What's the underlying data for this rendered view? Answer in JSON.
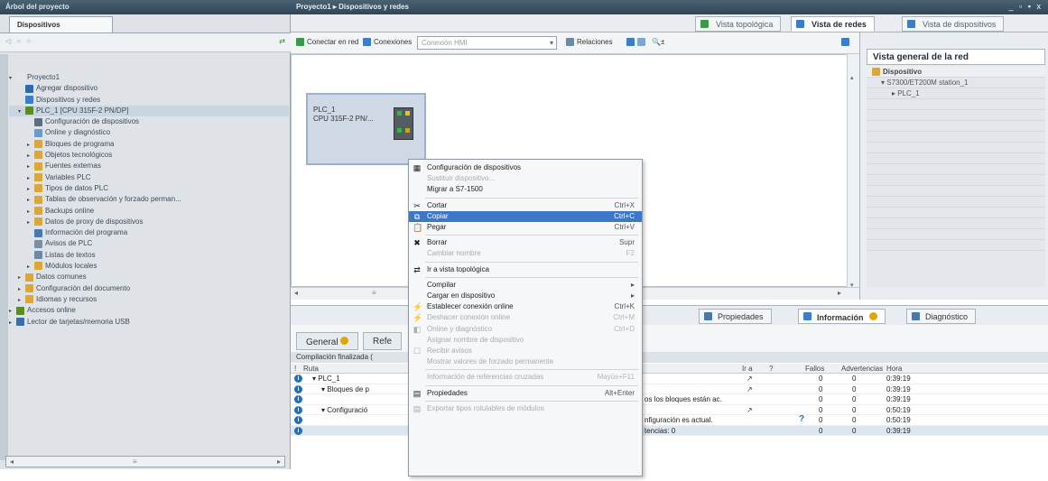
{
  "left_panel": {
    "title": "Árbol del proyecto",
    "tab": "Dispositivos",
    "tree": [
      {
        "label": "Proyecto1",
        "depth": 0,
        "arrow": "▾",
        "icon": "#e0e6ec"
      },
      {
        "label": "Agregar dispositivo",
        "depth": 1,
        "arrow": "",
        "icon": "#2b6cb0"
      },
      {
        "label": "Dispositivos y redes",
        "depth": 1,
        "arrow": "",
        "icon": "#3a7ec9"
      },
      {
        "label": "PLC_1 [CPU 315F-2 PN/DP]",
        "depth": 1,
        "arrow": "▾",
        "icon": "#5a8a2a",
        "selected": true
      },
      {
        "label": "Configuración de dispositivos",
        "depth": 2,
        "arrow": "",
        "icon": "#5e6e82"
      },
      {
        "label": "Online y diagnóstico",
        "depth": 2,
        "arrow": "",
        "icon": "#6a9ac9"
      },
      {
        "label": "Bloques de programa",
        "depth": 2,
        "arrow": "▸",
        "icon": "#d9a73a"
      },
      {
        "label": "Objetos tecnológicos",
        "depth": 2,
        "arrow": "▸",
        "icon": "#d9a73a"
      },
      {
        "label": "Fuentes externas",
        "depth": 2,
        "arrow": "▸",
        "icon": "#d9a73a"
      },
      {
        "label": "Variables PLC",
        "depth": 2,
        "arrow": "▸",
        "icon": "#d9a73a"
      },
      {
        "label": "Tipos de datos PLC",
        "depth": 2,
        "arrow": "▸",
        "icon": "#d9a73a"
      },
      {
        "label": "Tablas de observación y forzado perman...",
        "depth": 2,
        "arrow": "▸",
        "icon": "#d9a73a"
      },
      {
        "label": "Backups online",
        "depth": 2,
        "arrow": "▸",
        "icon": "#d9a73a"
      },
      {
        "label": "Datos de proxy de dispositivos",
        "depth": 2,
        "arrow": "▸",
        "icon": "#d9a73a"
      },
      {
        "label": "Información del programa",
        "depth": 2,
        "arrow": "",
        "icon": "#4a78a8"
      },
      {
        "label": "Avisos de PLC",
        "depth": 2,
        "arrow": "",
        "icon": "#7a8ea4"
      },
      {
        "label": "Listas de textos",
        "depth": 2,
        "arrow": "",
        "icon": "#6a8aa8"
      },
      {
        "label": "Módulos locales",
        "depth": 2,
        "arrow": "▸",
        "icon": "#d9a73a"
      },
      {
        "label": "Datos comunes",
        "depth": 1,
        "arrow": "▸",
        "icon": "#d9a73a"
      },
      {
        "label": "Configuración del documento",
        "depth": 1,
        "arrow": "▸",
        "icon": "#d9a73a"
      },
      {
        "label": "Idiomas y recursos",
        "depth": 1,
        "arrow": "▸",
        "icon": "#d9a73a"
      },
      {
        "label": "Accesos online",
        "depth": 0,
        "arrow": "▸",
        "icon": "#5a8a2a"
      },
      {
        "label": "Lector de tarjetas/memoria USB",
        "depth": 0,
        "arrow": "▸",
        "icon": "#3a6ea8"
      }
    ]
  },
  "header": {
    "breadcrumb": "Proyecto1 ▸ Dispositivos y redes",
    "window_controls": "_ ▫ ▪ x"
  },
  "view_tabs": [
    {
      "label": "Vista topológica",
      "active": false,
      "icon": "#3a9a4a"
    },
    {
      "label": "Vista de redes",
      "active": true,
      "icon": "#3a7ec9"
    },
    {
      "label": "Vista de dispositivos",
      "active": false,
      "icon": "#3a7ec9"
    }
  ],
  "net_toolbar": {
    "connect_label": "Conectar en red",
    "connections_label": "Conexiones",
    "connection_type": "Conexión HMI",
    "relations_label": "Relaciones",
    "zoom_label": "± "
  },
  "plc": {
    "name": "PLC_1",
    "cpu": "CPU 315F-2 PN/..."
  },
  "overview": {
    "title": "Vista general de la red",
    "header": "Dispositivo",
    "rows": [
      "S7300/ET200M station_1",
      "PLC_1"
    ]
  },
  "bottom_tabs": [
    {
      "label": "Propiedades",
      "active": false
    },
    {
      "label": "Información",
      "active": true
    },
    {
      "label": "Diagnóstico",
      "active": false
    }
  ],
  "sub_tabs": [
    "General",
    "Refe"
  ],
  "compile_status": "Compilación finalizada (",
  "table": {
    "headers": {
      "path": "Ruta",
      "ir": "Ir a",
      "q": "?",
      "errors": "Fallos",
      "warnings": "Advertencias",
      "time": "Hora"
    },
    "rows": [
      {
        "path": "▾ PLC_1",
        "desc": "",
        "arrow": "↗",
        "q": "",
        "errors": "0",
        "warnings": "0",
        "time": "0:39:19",
        "indent": 10,
        "selected": false
      },
      {
        "path": "▾ Bloques de p",
        "desc": "",
        "arrow": "↗",
        "q": "",
        "errors": "0",
        "warnings": "0",
        "time": "0:39:19",
        "indent": 20,
        "selected": false
      },
      {
        "path": "",
        "desc": "os los bloques están ac.",
        "arrow": "",
        "q": "",
        "errors": "0",
        "warnings": "0",
        "time": "0:39:19",
        "indent": 30,
        "selected": false
      },
      {
        "path": "▾ Configuració",
        "desc": "",
        "arrow": "↗",
        "q": "",
        "errors": "0",
        "warnings": "0",
        "time": "0:50:19",
        "indent": 20,
        "selected": false
      },
      {
        "path": "",
        "desc": "nfiguración es actual.",
        "arrow": "",
        "q": "?",
        "errors": "0",
        "warnings": "0",
        "time": "0:50:19",
        "indent": 30,
        "selected": false
      },
      {
        "path": "",
        "desc": "tencias: 0",
        "arrow": "",
        "q": "",
        "errors": "0",
        "warnings": "0",
        "time": "0:39:19",
        "indent": 30,
        "selected": true
      }
    ]
  },
  "context_menu": [
    {
      "label": "Configuración de dispositivos",
      "shortcut": "",
      "disabled": false,
      "icon": "▦"
    },
    {
      "label": "Sustituir dispositivo...",
      "shortcut": "",
      "disabled": true,
      "icon": ""
    },
    {
      "label": "Migrar a S7-1500",
      "shortcut": "",
      "disabled": false,
      "icon": ""
    },
    {
      "sep": true
    },
    {
      "label": "Cortar",
      "shortcut": "Ctrl+X",
      "disabled": false,
      "icon": "✂"
    },
    {
      "label": "Copiar",
      "shortcut": "Ctrl+C",
      "disabled": false,
      "icon": "⧉",
      "highlight": true
    },
    {
      "label": "Pegar",
      "shortcut": "Ctrl+V",
      "disabled": false,
      "icon": "📋"
    },
    {
      "sep": true
    },
    {
      "label": "Borrar",
      "shortcut": "Supr",
      "disabled": false,
      "icon": "✖"
    },
    {
      "label": "Cambiar nombre",
      "shortcut": "F2",
      "disabled": true,
      "icon": ""
    },
    {
      "sep": true
    },
    {
      "label": "Ir a vista topológica",
      "shortcut": "",
      "disabled": false,
      "icon": "⇄"
    },
    {
      "sep": true
    },
    {
      "label": "Compilar",
      "shortcut": "▸",
      "disabled": false,
      "icon": ""
    },
    {
      "label": "Cargar en dispositivo",
      "shortcut": "▸",
      "disabled": false,
      "icon": ""
    },
    {
      "label": "Establecer conexión online",
      "shortcut": "Ctrl+K",
      "disabled": false,
      "icon": "⚡"
    },
    {
      "label": "Deshacer conexión online",
      "shortcut": "Ctrl+M",
      "disabled": true,
      "icon": "⚡"
    },
    {
      "label": "Online y diagnóstico",
      "shortcut": "Ctrl+D",
      "disabled": true,
      "icon": "◧"
    },
    {
      "label": "Asignar nombre de dispositivo",
      "shortcut": "",
      "disabled": true,
      "icon": ""
    },
    {
      "label": "Recibir avisos",
      "shortcut": "",
      "disabled": true,
      "icon": "☐"
    },
    {
      "label": "Mostrar valores de forzado permanente",
      "shortcut": "",
      "disabled": true,
      "icon": ""
    },
    {
      "sep": true
    },
    {
      "label": "Información de referencias cruzadas",
      "shortcut": "Mayús+F11",
      "disabled": true,
      "icon": ""
    },
    {
      "sep": true
    },
    {
      "label": "Propiedades",
      "shortcut": "Alt+Enter",
      "disabled": false,
      "icon": "▤"
    },
    {
      "sep": true
    },
    {
      "label": "Exportar tipos rotulables de módulos",
      "shortcut": "",
      "disabled": true,
      "icon": "▤"
    }
  ]
}
